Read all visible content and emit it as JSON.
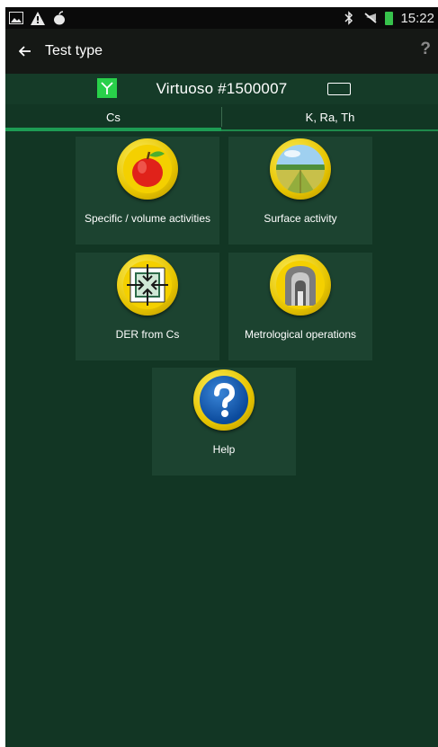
{
  "status_bar": {
    "time": "15:22",
    "left_icons": [
      "image-icon",
      "warning-icon",
      "apple-notification-icon"
    ],
    "right_icons": [
      "bluetooth-icon",
      "mute-icon",
      "battery-icon"
    ]
  },
  "action_bar": {
    "title": "Test type",
    "help_label": "?"
  },
  "device": {
    "name": "Virtuoso #1500007"
  },
  "tabs": [
    {
      "label": "Cs",
      "active": true
    },
    {
      "label": "K, Ra, Th",
      "active": false
    }
  ],
  "tiles": [
    {
      "label": "Specific / volume activities",
      "icon": "apple-icon"
    },
    {
      "label": "Surface activity",
      "icon": "field-icon"
    },
    {
      "label": "DER from Cs",
      "icon": "der-icon"
    },
    {
      "label": "Metrological operations",
      "icon": "metrology-icon"
    },
    {
      "label": "Help",
      "icon": "help-icon"
    }
  ],
  "colors": {
    "background": "#123624",
    "tile": "#1c4330",
    "accent": "#1d9c54",
    "antenna": "#29d04a"
  }
}
